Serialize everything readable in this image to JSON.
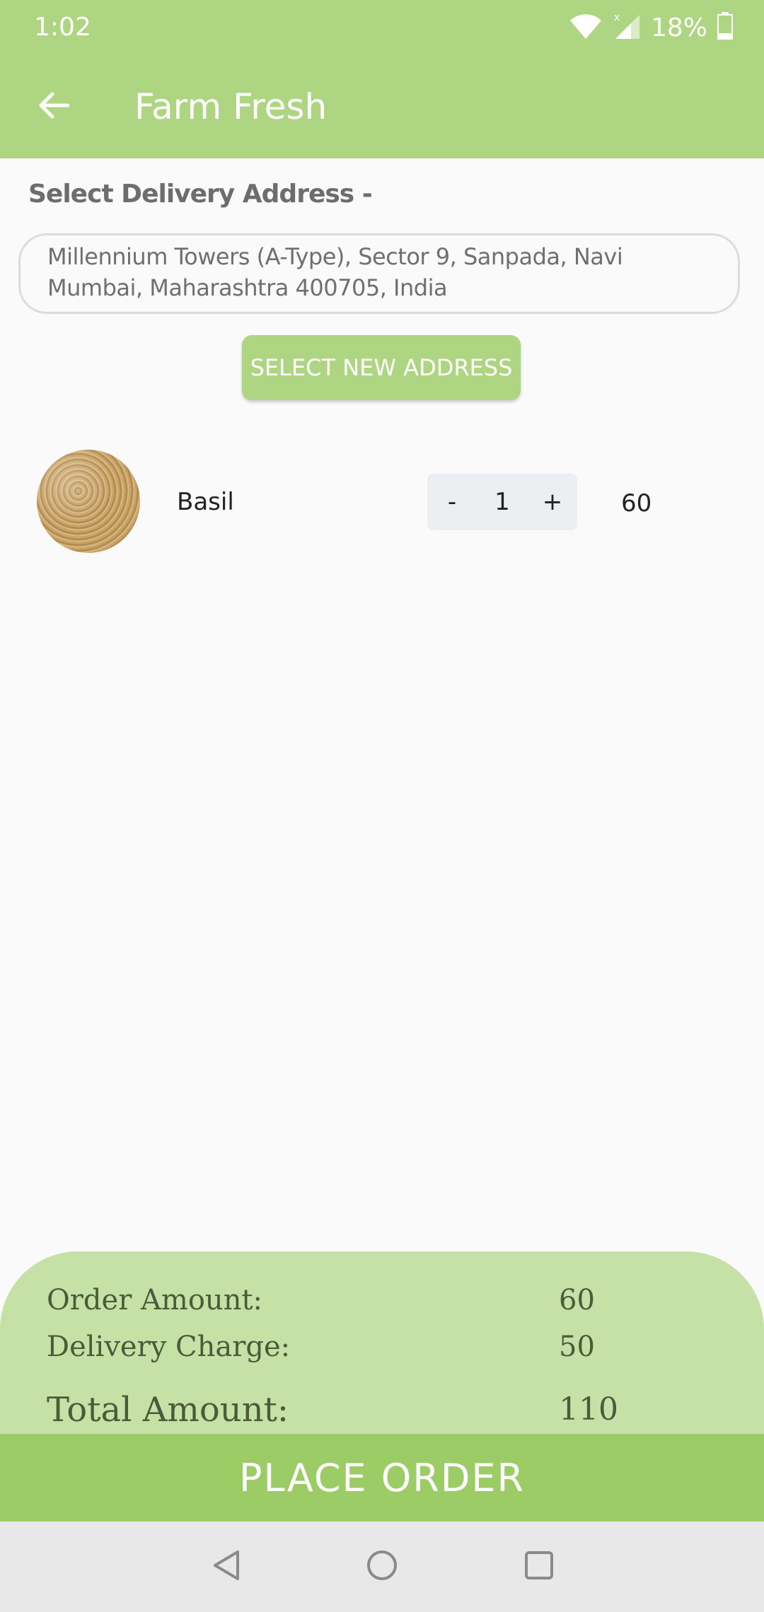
{
  "status_bar": {
    "time": "1:02",
    "battery": "18%"
  },
  "app_bar": {
    "title": "Farm Fresh"
  },
  "address": {
    "label": "Select Delivery Address -",
    "value": "Millennium Towers (A-Type), Sector 9, Sanpada, Navi Mumbai, Maharashtra 400705, India",
    "select_button": "SELECT NEW ADDRESS"
  },
  "cart": {
    "items": [
      {
        "name": "Basil",
        "quantity": "1",
        "decrement": "-",
        "increment": "+",
        "price": "60"
      }
    ]
  },
  "summary": {
    "order_amount_label": "Order Amount:",
    "order_amount": "60",
    "delivery_charge_label": "Delivery Charge:",
    "delivery_charge": "50",
    "total_label": "Total Amount:",
    "total": "110"
  },
  "actions": {
    "place_order": "PLACE ORDER"
  },
  "colors": {
    "primary": "#aed581",
    "summary_bg": "#c5e1a5",
    "button": "#9ccc65"
  }
}
